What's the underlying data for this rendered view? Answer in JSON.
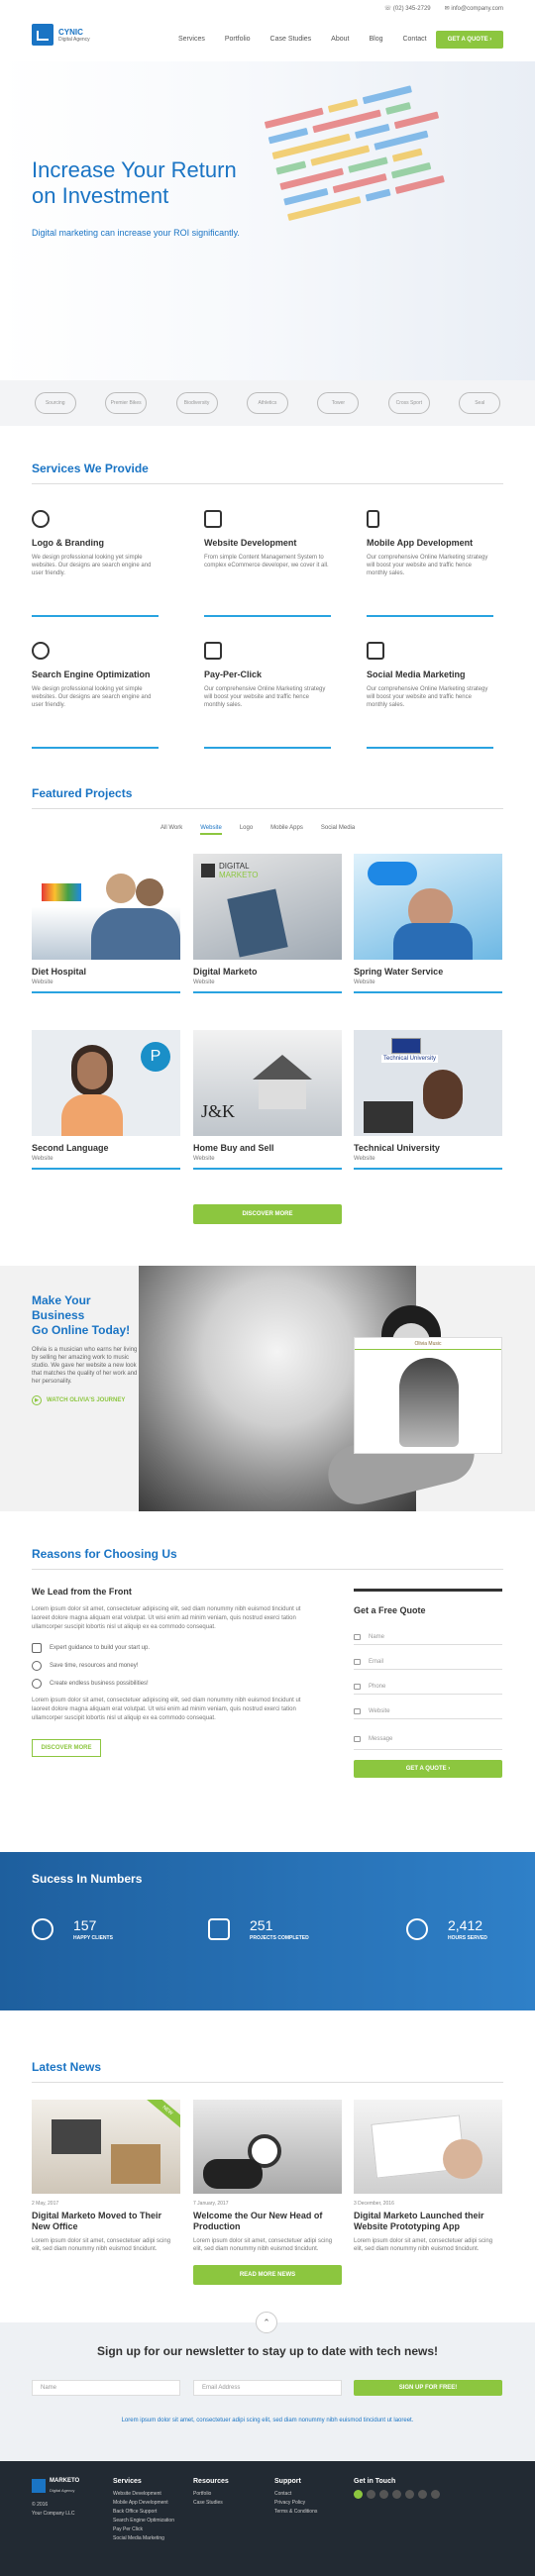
{
  "header": {
    "brand_name": "CYNIC",
    "brand_sub": "Digital Agency",
    "phone": "(02) 345-2729",
    "email": "info@company.com",
    "nav": [
      "Services",
      "Portfolio",
      "Case Studies",
      "About",
      "Blog",
      "Contact"
    ],
    "cta": "GET A QUOTE"
  },
  "hero": {
    "title_line1": "Increase Your Return",
    "title_line2": "on Investment",
    "subtitle": "Digital marketing can increase your ROI significantly."
  },
  "partners": [
    "Sourcing",
    "Premier Bikes",
    "Biodiversity",
    "Athletics",
    "Tower",
    "Cross Sport",
    "Seal"
  ],
  "services": {
    "title": "Services We Provide",
    "items": [
      {
        "title": "Logo & Branding",
        "text": "We design professional looking yet simple websites. Our designs are search engine and user friendly."
      },
      {
        "title": "Website Development",
        "text": "From simple Content Management System to complex eCommerce developer, we cover it all."
      },
      {
        "title": "Mobile App Development",
        "text": "Our comprehensive Online Marketing strategy will boost your website and traffic hence monthly sales."
      },
      {
        "title": "Search Engine Optimization",
        "text": "We design professional looking yet simple websites. Our designs are search engine and user friendly."
      },
      {
        "title": "Pay-Per-Click",
        "text": "Our comprehensive Online Marketing strategy will boost your website and traffic hence monthly sales."
      },
      {
        "title": "Social Media Marketing",
        "text": "Our comprehensive Online Marketing strategy will boost your website and traffic hence monthly sales."
      }
    ]
  },
  "projects": {
    "title": "Featured Projects",
    "tabs": [
      "All Work",
      "Website",
      "Logo",
      "Mobile Apps",
      "Social Media"
    ],
    "items": [
      {
        "title": "Diet Hospital",
        "cat": "Website"
      },
      {
        "title": "Digital Marketo",
        "cat": "Website"
      },
      {
        "title": "Spring Water Service",
        "cat": "Website"
      },
      {
        "title": "Second Language",
        "cat": "Website"
      },
      {
        "title": "Home Buy and Sell",
        "cat": "Website"
      },
      {
        "title": "Technical University",
        "cat": "Website"
      }
    ],
    "img_text": {
      "digital": "DIGITAL",
      "marketo": "MARKETO",
      "jk": "J&K",
      "tech": "Technical University"
    },
    "button": "DISCOVER MORE"
  },
  "olivia": {
    "title_line1": "Make Your Business",
    "title_line2": "Go Online Today!",
    "text": "Olivia is a musician who earns her living by selling her amazing work to music studio. We gave her website a new look that matches the quality of her work and her personality.",
    "link": "WATCH OLIVIA'S JOURNEY",
    "card_label": "Olivia Music"
  },
  "reasons": {
    "title": "Reasons for Choosing Us",
    "subtitle": "We Lead from the Front",
    "p1": "Lorem ipsum dolor sit amet, consectetuer adipiscing elit, sed diam nonummy nibh euismod tincidunt ut laoreet dolore magna aliquam erat volutpat. Ut wisi enim ad minim veniam, quis nostrud exerci tation ullamcorper suscipit lobortis nisl ut aliquip ex ea commodo consequat.",
    "bullets": [
      "Expert guidance to build your start up.",
      "Save time, resources and money!",
      "Create endless business possibilities!"
    ],
    "p2": "Lorem ipsum dolor sit amet, consectetuer adipiscing elit, sed diam nonummy nibh euismod tincidunt ut laoreet dolore magna aliquam erat volutpat. Ut wisi enim ad minim veniam, quis nostrud exerci tation ullamcorper suscipit lobortis nisl ut aliquip ex ea commodo consequat.",
    "button": "DISCOVER MORE"
  },
  "quote_form": {
    "title": "Get a Free Quote",
    "fields": [
      "Name",
      "Email",
      "Phone",
      "Website",
      "Message"
    ],
    "button": "GET A QUOTE"
  },
  "numbers": {
    "title": "Sucess In Numbers",
    "stats": [
      {
        "value": "157",
        "label": "HAPPY CLIENTS"
      },
      {
        "value": "251",
        "label": "PROJECTS COMPLETED"
      },
      {
        "value": "2,412",
        "label": "HOURS SERVED"
      }
    ]
  },
  "news": {
    "title": "Latest News",
    "items": [
      {
        "date": "2 May, 2017",
        "title": "Digital Marketo Moved to Their New Office",
        "text": "Lorem ipsum dolor sit amet, consectetuer adipi scing elit, sed diam nonummy nibh euismod tincidunt."
      },
      {
        "date": "7 January, 2017",
        "title": "Welcome the Our New Head of Production",
        "text": "Lorem ipsum dolor sit amet, consectetuer adipi scing elit, sed diam nonummy nibh euismod tincidunt."
      },
      {
        "date": "3 December, 2016",
        "title": "Digital Marketo Launched their Website Prototyping App",
        "text": "Lorem ipsum dolor sit amet, consectetuer adipi scing elit, sed diam nonummy nibh euismod tincidunt."
      }
    ],
    "button": "READ MORE NEWS",
    "badge": "NEW"
  },
  "newsletter": {
    "title": "Sign up for our newsletter to stay up to date with tech news!",
    "name_placeholder": "Name",
    "email_placeholder": "Email Address",
    "button": "SIGN UP FOR FREE!",
    "small": "Lorem ipsum dolor sit amet, consectetuer adipi scing elit, sed diam nonummy nibh euismod tincidunt ut laoreet."
  },
  "footer": {
    "brand": "MARKETO",
    "brand_sub": "Digital Agency",
    "copyright": "© 2016",
    "company": "Your Company LLC",
    "services_title": "Services",
    "services": [
      "Website Development",
      "Mobile App Development",
      "Back Office Support",
      "Search Engine Optimization",
      "Pay Per Click",
      "Social Media Marketing"
    ],
    "resources_title": "Resources",
    "resources": [
      "Portfolio",
      "Case Studies"
    ],
    "support_title": "Support",
    "support": [
      "Contact",
      "Privacy Policy",
      "Terms & Conditions"
    ],
    "touch_title": "Get in Touch"
  },
  "colors": {
    "primary": "#1a74c4",
    "accent": "#8cc63f",
    "line": "#29a3e0",
    "footer": "#222a33"
  }
}
